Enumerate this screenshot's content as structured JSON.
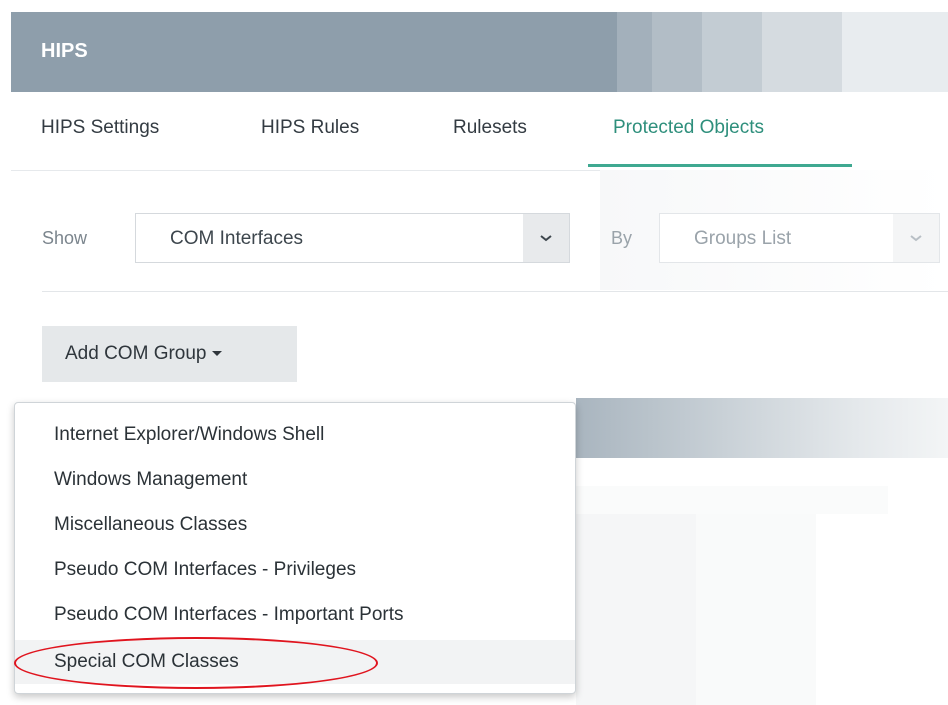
{
  "header": {
    "title": "HIPS"
  },
  "tabs": [
    {
      "label": "HIPS Settings",
      "active": false
    },
    {
      "label": "HIPS Rules",
      "active": false
    },
    {
      "label": "Rulesets",
      "active": false
    },
    {
      "label": "Protected Objects",
      "active": true
    }
  ],
  "filter": {
    "show_label": "Show",
    "show_value": "COM Interfaces",
    "by_label": "By",
    "by_value": "Groups List"
  },
  "add_button": {
    "label": "Add COM Group"
  },
  "menu": {
    "items": [
      "Internet Explorer/Windows Shell",
      "Windows Management",
      "Miscellaneous Classes",
      "Pseudo COM Interfaces - Privileges",
      "Pseudo COM Interfaces - Important Ports",
      "Special COM Classes"
    ],
    "highlighted": "Special COM Classes"
  },
  "colors": {
    "header_bg": "#8e9eab",
    "active_tab": "#2e8f7c",
    "tab_underline": "#3fa991",
    "highlight_ring": "#e0141e"
  },
  "icons": {
    "dropdown": "chevron-down-icon",
    "caret": "caret-down-icon"
  }
}
